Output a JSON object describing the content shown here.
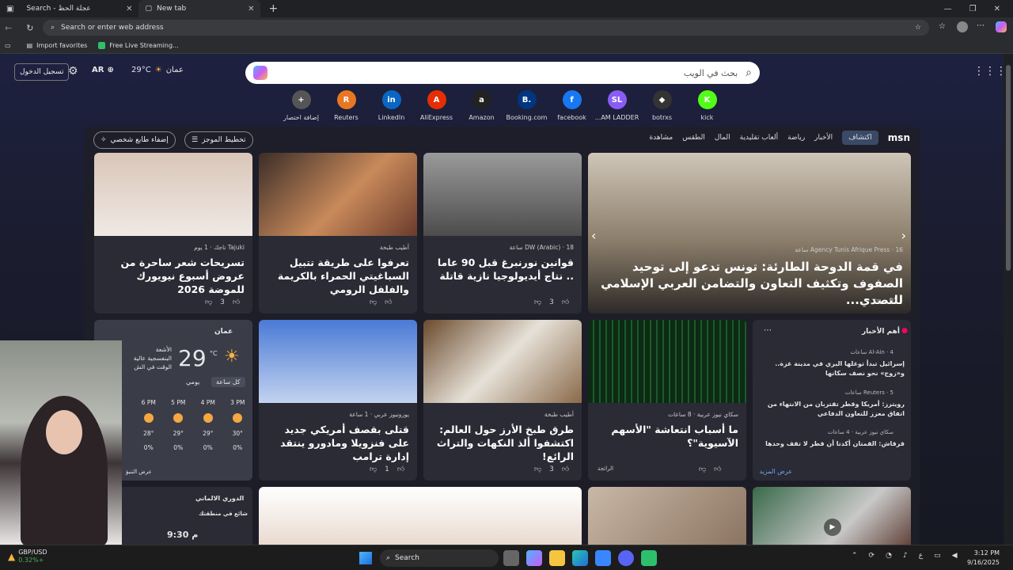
{
  "browser": {
    "tabs": [
      {
        "label": "Search - عجلة الحظ",
        "active": false
      },
      {
        "label": "New tab",
        "active": true
      }
    ],
    "address_placeholder": "Search or enter web address",
    "favorites": [
      "Import favorites",
      "Free Live Streaming..."
    ]
  },
  "msn": {
    "login_label": "تسجيل الدخول",
    "lang_label": "AR",
    "temp_top": "29°C",
    "city_top": "عمان",
    "search_placeholder": "بحث في الويب",
    "shortcuts": [
      {
        "label": "إضافة اختصار",
        "icon": "+",
        "color": "#555"
      },
      {
        "label": "Reuters",
        "icon": "R",
        "color": "#e87722"
      },
      {
        "label": "LinkedIn",
        "icon": "in",
        "color": "#0a66c2"
      },
      {
        "label": "AliExpress",
        "icon": "A",
        "color": "#e62e04"
      },
      {
        "label": "Amazon",
        "icon": "a",
        "color": "#222"
      },
      {
        "label": "Booking.com",
        "icon": "B.",
        "color": "#003580"
      },
      {
        "label": "facebook",
        "icon": "f",
        "color": "#1877f2"
      },
      {
        "label": "...AM LADDER",
        "icon": "SL",
        "color": "#8a5cf6"
      },
      {
        "label": "botrxs",
        "icon": "◆",
        "color": "#333"
      },
      {
        "label": "kick",
        "icon": "K",
        "color": "#53fc18"
      }
    ],
    "nav": [
      "اكتشاف",
      "الأخبار",
      "رياضة",
      "ألعاب تقليدية",
      "المال",
      "الطقس",
      "مشاهدة"
    ],
    "brand": "msn",
    "pill_personalize": "إضفاء طابع شخصي",
    "pill_layout": "تخطيط الموجز",
    "cards": [
      {
        "source": "Agency Tunis Afrique Press · 16 ساعة",
        "title": "في قمة الدوحة الطارئة: تونس تدعو إلى توحيد الصفوف وتكثيف التعاون والتضامن العربي الإسلامي للتصدي..."
      },
      {
        "source": "DW (Arabic) · 18 ساعة",
        "title": "قوانين نورنبرغ قبل 90 عاما .. نتاج أيديولوجيا نازية قاتلة",
        "likes": "3"
      },
      {
        "source": "أطيب طبخة",
        "title": "تعرفوا على طريقة تتبيل السباغيتي الحمراء بالكريمة والفلفل الرومي"
      },
      {
        "source": "Tajuki تاجك · 1 يوم",
        "title": "تسريحات شعر ساحرة من عروض أسبوع نيويورك للموضة 2026",
        "likes": "3"
      },
      {
        "source": "سكاي نيوز عربية · 8 ساعات",
        "title": "ما أسباب انتعاشة \"الأسهم الآسيوية\"؟",
        "tag": "الرائجة"
      },
      {
        "source": "أطيب طبخة",
        "title": "طرق طبخ الأرز حول العالم: اكتشفوا ألذ النكهات والتراث الرائع!",
        "likes": "3"
      },
      {
        "source": "يورونيوز عربي · 1 ساعة",
        "title": "قتلى بقصف أمريكي جديد على فنزويلا ومادورو ينتقد إدارة ترامب",
        "likes": "1"
      }
    ],
    "top_news": {
      "title": "أهم الأخبار",
      "items": [
        {
          "source": "Al-Ain · 4 ساعات",
          "text": "إسرائيل تبدأ توغلها البري في مدينة غزة.. و«زوج» نحو نصف سكانها"
        },
        {
          "source": "Reuters · 5 ساعات",
          "text": "رويترز: أمريكا وقطر تقتربان من الانتهاء من اتفاق معزز للتعاون الدفاعي"
        },
        {
          "source": "سكاي نيوز عربية · 4 ساعات",
          "text": "قرقاش: القمتان أكدتا أن قطر لا تقف وحدها"
        }
      ],
      "more": "عرض المزيد"
    },
    "weather": {
      "city": "عمان",
      "temp": "29",
      "unit": "°C",
      "desc": "الأشعة البنفسجية عالية الوقت في الش",
      "tabs": [
        "كل ساعة",
        "يومي"
      ],
      "hours": [
        "3 PM",
        "4 PM",
        "5 PM",
        "6 PM"
      ],
      "temps": [
        "30°",
        "29°",
        "29°",
        "28°"
      ],
      "rain": [
        "0%",
        "0%",
        "0%",
        "0%"
      ],
      "forecast": "عرض التنبؤ"
    },
    "league": {
      "title": "الدوري الالماني",
      "sub": "شائع في منطقتك",
      "time": "9:30 م"
    }
  },
  "taskbar": {
    "ticker": "GBP/USD",
    "ticker_val": "0.32%+",
    "search": "Search",
    "lang": "ع",
    "time": "3:12 PM",
    "date": "9/16/2025"
  }
}
